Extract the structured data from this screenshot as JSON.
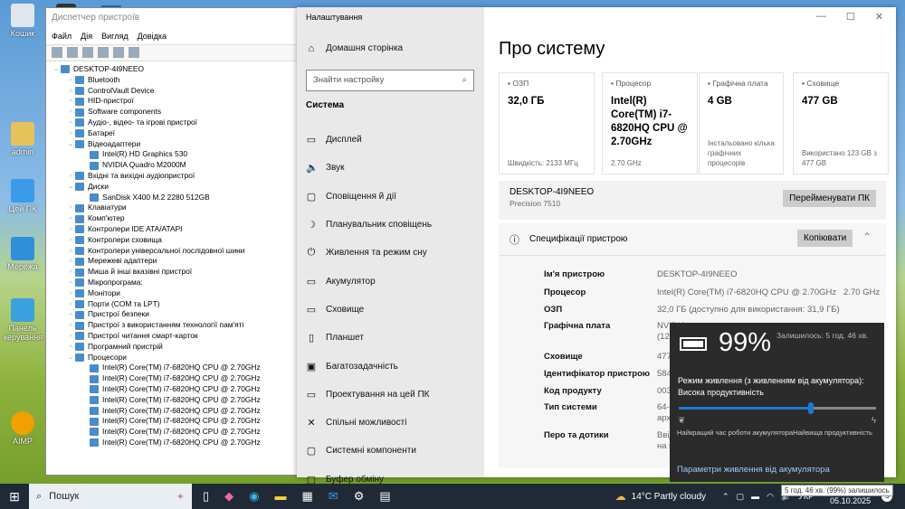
{
  "desktop": {
    "icons": [
      "Кошик",
      "admin",
      "Цей ПК",
      "Мережа",
      "Панель керування",
      "AIMP"
    ]
  },
  "device_manager": {
    "title": "Диспетчер пристроїв",
    "menu": [
      "Файл",
      "Дія",
      "Вигляд",
      "Довідка"
    ],
    "tree": [
      {
        "t": "DESKTOP-4I9NEEO",
        "l": 0,
        "e": "⌄"
      },
      {
        "t": "Bluetooth",
        "l": 1,
        "e": "›"
      },
      {
        "t": "ControlVault Device",
        "l": 1,
        "e": "›"
      },
      {
        "t": "HID-пристрої",
        "l": 1,
        "e": "›"
      },
      {
        "t": "Software components",
        "l": 1,
        "e": "›"
      },
      {
        "t": "Аудіо-, відео- та ігрові пристрої",
        "l": 1,
        "e": "›"
      },
      {
        "t": "Батареї",
        "l": 1,
        "e": "›"
      },
      {
        "t": "Відеоадаптери",
        "l": 1,
        "e": "⌄"
      },
      {
        "t": "Intel(R) HD Graphics 530",
        "l": 2,
        "e": ""
      },
      {
        "t": "NVIDIA Quadro M2000M",
        "l": 2,
        "e": ""
      },
      {
        "t": "Вхідні та вихідні аудіопристрої",
        "l": 1,
        "e": "›"
      },
      {
        "t": "Диски",
        "l": 1,
        "e": "⌄"
      },
      {
        "t": "SanDisk X400 M.2 2280 512GB",
        "l": 2,
        "e": ""
      },
      {
        "t": "Клавіатури",
        "l": 1,
        "e": "›"
      },
      {
        "t": "Комп'ютер",
        "l": 1,
        "e": "›"
      },
      {
        "t": "Контролери IDE ATA/ATAPI",
        "l": 1,
        "e": "›"
      },
      {
        "t": "Контролери сховища",
        "l": 1,
        "e": "›"
      },
      {
        "t": "Контролери універсальної послідовної шини",
        "l": 1,
        "e": "›"
      },
      {
        "t": "Мережеві адаптери",
        "l": 1,
        "e": "›"
      },
      {
        "t": "Миша й інші вказівні пристрої",
        "l": 1,
        "e": "›"
      },
      {
        "t": "Мікропрограма:",
        "l": 1,
        "e": "›"
      },
      {
        "t": "Монітори",
        "l": 1,
        "e": "›"
      },
      {
        "t": "Порти (COM та LPT)",
        "l": 1,
        "e": "›"
      },
      {
        "t": "Пристрої безпеки",
        "l": 1,
        "e": "›"
      },
      {
        "t": "Пристрої з використанням технології пам'яті",
        "l": 1,
        "e": "›"
      },
      {
        "t": "Пристрої читання смарт-карток",
        "l": 1,
        "e": "›"
      },
      {
        "t": "Програмний пристрій",
        "l": 1,
        "e": "›"
      },
      {
        "t": "Процесори",
        "l": 1,
        "e": "⌄"
      },
      {
        "t": "Intel(R) Core(TM) i7-6820HQ CPU @ 2.70GHz",
        "l": 2,
        "e": ""
      },
      {
        "t": "Intel(R) Core(TM) i7-6820HQ CPU @ 2.70GHz",
        "l": 2,
        "e": ""
      },
      {
        "t": "Intel(R) Core(TM) i7-6820HQ CPU @ 2.70GHz",
        "l": 2,
        "e": ""
      },
      {
        "t": "Intel(R) Core(TM) i7-6820HQ CPU @ 2.70GHz",
        "l": 2,
        "e": ""
      },
      {
        "t": "Intel(R) Core(TM) i7-6820HQ CPU @ 2.70GHz",
        "l": 2,
        "e": ""
      },
      {
        "t": "Intel(R) Core(TM) i7-6820HQ CPU @ 2.70GHz",
        "l": 2,
        "e": ""
      },
      {
        "t": "Intel(R) Core(TM) i7-6820HQ CPU @ 2.70GHz",
        "l": 2,
        "e": ""
      },
      {
        "t": "Intel(R) Core(TM) i7-6820HQ CPU @ 2.70GHz",
        "l": 2,
        "e": ""
      }
    ]
  },
  "settings": {
    "window_title": "Налаштування",
    "home": "Домашня сторінка",
    "search_placeholder": "Знайти настройку",
    "section": "Система",
    "nav": [
      {
        "i": "▭",
        "t": "Дисплей"
      },
      {
        "i": "🔈",
        "t": "Звук"
      },
      {
        "i": "▢",
        "t": "Сповіщення й дії"
      },
      {
        "i": "☽",
        "t": "Планувальник сповіщень"
      },
      {
        "i": "⏻",
        "t": "Живлення та режим сну"
      },
      {
        "i": "▭",
        "t": "Акумулятор"
      },
      {
        "i": "▭",
        "t": "Сховище"
      },
      {
        "i": "▯",
        "t": "Планшет"
      },
      {
        "i": "▣",
        "t": "Багатозадачність"
      },
      {
        "i": "▭",
        "t": "Проектування на цей ПК"
      },
      {
        "i": "✕",
        "t": "Спільні можливості"
      },
      {
        "i": "▢",
        "t": "Системні компоненти"
      },
      {
        "i": "▢",
        "t": "Буфер обміну"
      }
    ],
    "page_title": "Про систему",
    "cards": [
      {
        "label": "ОЗП",
        "value": "32,0 ГБ",
        "foot": "Швидкість: 2133 МГц"
      },
      {
        "label": "Процесор",
        "value": "Intel(R) Core(TM) i7-6820HQ CPU @ 2.70GHz",
        "foot": "2.70 GHz"
      },
      {
        "label": "Графічна плата",
        "value": "4 GB",
        "foot": "Інстальовано кілька графічних процесорів"
      },
      {
        "label": "Сховище",
        "value": "477 GB",
        "foot": "Використано 123 GB з 477 GB"
      }
    ],
    "device_name": "DESKTOP-4I9NEEO",
    "model": "Precision 7510",
    "rename": "Перейменувати ПК",
    "specs_title": "Специфікації пристрою",
    "copy": "Копіювати",
    "specs": [
      {
        "k": "Ім'я пристрою",
        "v": "DESKTOP-4I9NEEO"
      },
      {
        "k": "Процесор",
        "v": "Intel(R) Core(TM) i7-6820HQ CPU @ 2.70GHz   2.70 GHz"
      },
      {
        "k": "ОЗП",
        "v": "32,0 ГБ (доступно для використання: 31,9 ГБ)"
      },
      {
        "k": "Графічна плата",
        "v": "NVIDIA\n(128 MB"
      },
      {
        "k": "Сховище",
        "v": "477 GB"
      },
      {
        "k": "Ідентифікатор пристрою",
        "v": "5848DC"
      },
      {
        "k": "Код продукту",
        "v": "00342-"
      },
      {
        "k": "Тип системи",
        "v": "64-роз\nархітек"
      },
      {
        "k": "Перо та дотики",
        "v": "Ввід за\nна цьо"
      }
    ]
  },
  "battery": {
    "percent": "99%",
    "remaining": "Залишилось: 5 год. 46 хв.",
    "mode_label": "Режим живлення (з живленням від акумулятора):",
    "mode_value": "Висока продуктивність",
    "slider_level": 0.67,
    "left_label": "Найкращий час роботи акумулятора",
    "right_label": "Найвища продуктивність",
    "link": "Параметри живлення від акумулятора",
    "accent": "#1e78d6"
  },
  "taskbar": {
    "search": "Пошук",
    "weather": "14°C  Partly cloudy",
    "lang": "УКР",
    "date": "05.10.2025",
    "tooltip": "5 год. 46 хв. (99%) залишилось",
    "notif_count": "5"
  }
}
